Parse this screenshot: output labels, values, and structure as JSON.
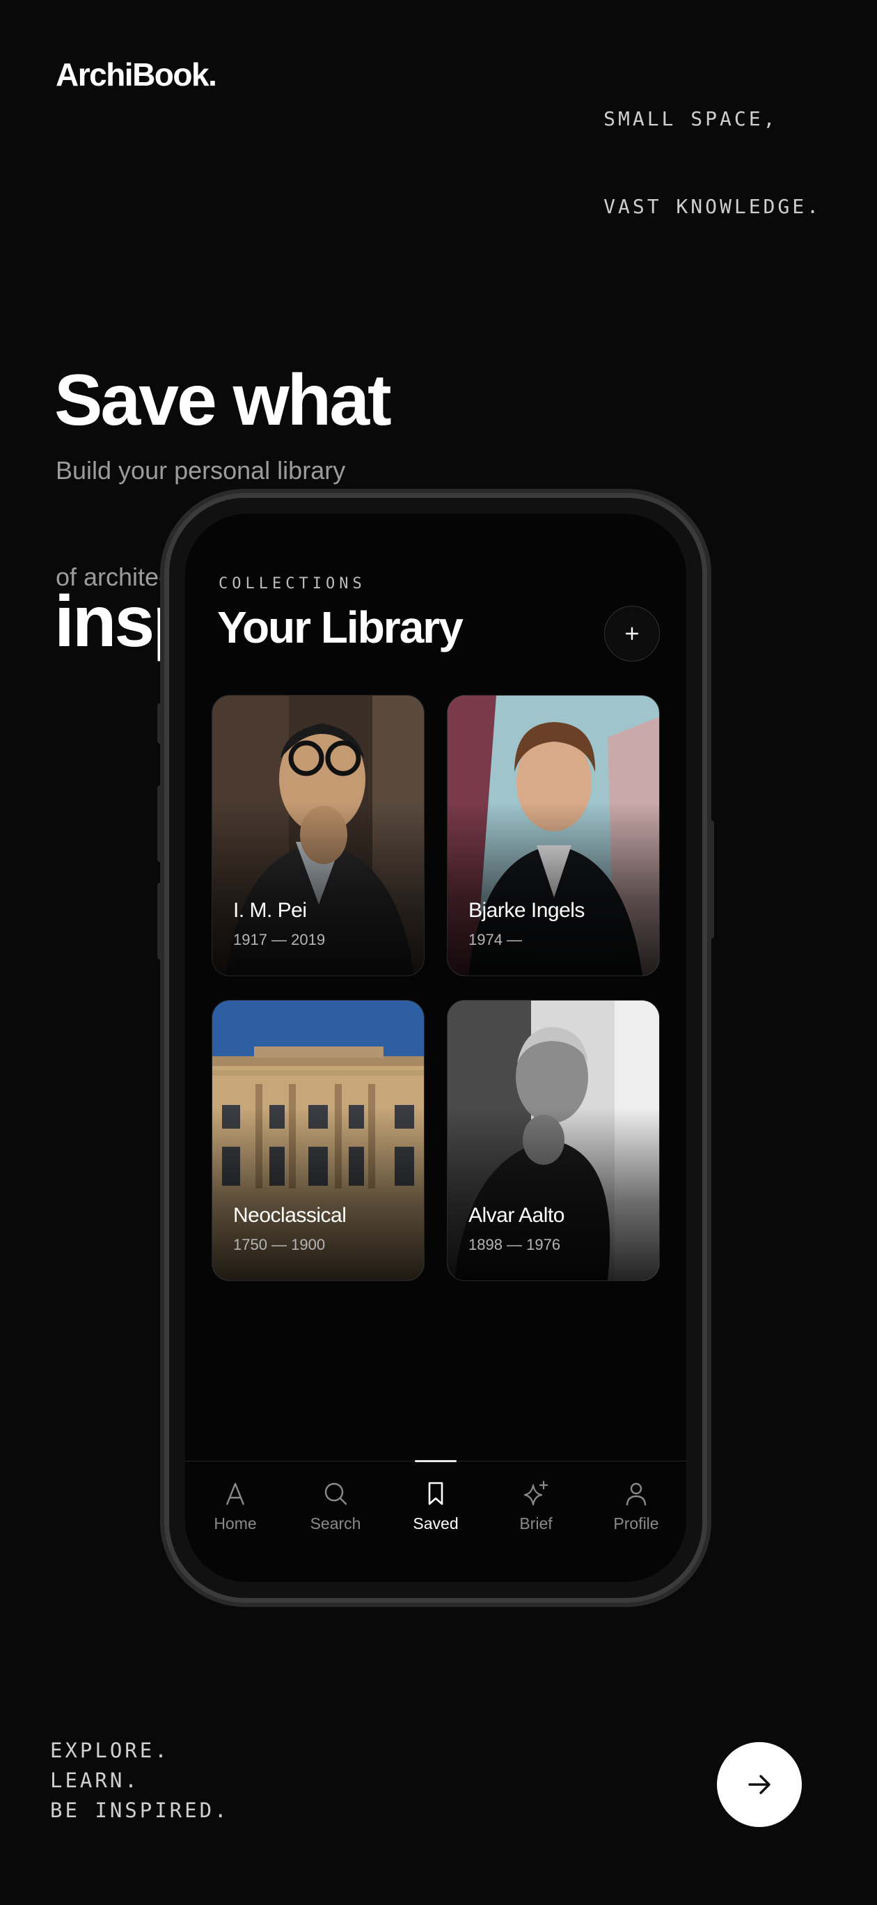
{
  "brand": "ArchiBook.",
  "tagline_top": [
    "SMALL SPACE,",
    "VAST KNOWLEDGE."
  ],
  "hero": {
    "title_lines": [
      "Save what",
      "inspires you."
    ],
    "subtitle_lines": [
      "Build your personal library",
      "of architects, styles, and moments."
    ]
  },
  "phone": {
    "eyebrow": "COLLECTIONS",
    "title": "Your Library",
    "add_icon": "plus-icon",
    "cards": [
      {
        "name": "I. M. Pei",
        "years": "1917 — 2019"
      },
      {
        "name": "Bjarke Ingels",
        "years": "1974 —"
      },
      {
        "name": "Neoclassical",
        "years": "1750 — 1900"
      },
      {
        "name": "Alvar Aalto",
        "years": "1898 — 1976"
      }
    ],
    "tabs": [
      {
        "label": "Home",
        "icon": "letter-a-icon"
      },
      {
        "label": "Search",
        "icon": "search-icon"
      },
      {
        "label": "Saved",
        "icon": "bookmark-icon",
        "active": true
      },
      {
        "label": "Brief",
        "icon": "sparkle-icon"
      },
      {
        "label": "Profile",
        "icon": "person-icon"
      }
    ]
  },
  "tagline_bottom": [
    "EXPLORE.",
    "LEARN.",
    "BE INSPIRED."
  ],
  "cta_icon": "arrow-right-icon"
}
